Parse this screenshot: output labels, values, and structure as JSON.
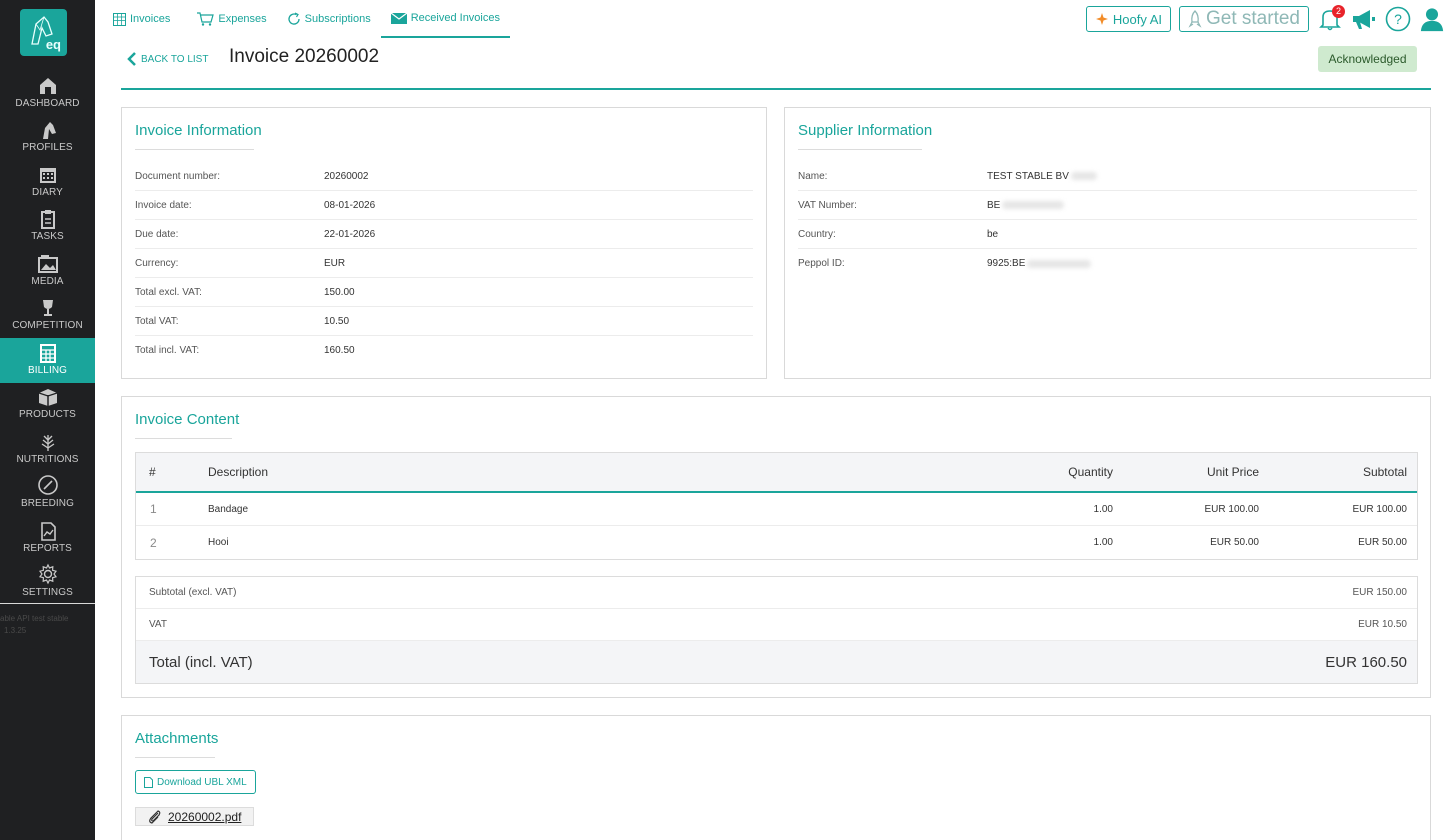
{
  "sidebar": {
    "logo_text": "eq",
    "items": [
      {
        "label": "DASHBOARD",
        "icon": "barn-icon"
      },
      {
        "label": "PROFILES",
        "icon": "horse-head-icon"
      },
      {
        "label": "DIARY",
        "icon": "calendar-icon"
      },
      {
        "label": "TASKS",
        "icon": "clipboard-icon"
      },
      {
        "label": "MEDIA",
        "icon": "media-icon"
      },
      {
        "label": "COMPETITION",
        "icon": "trophy-icon"
      },
      {
        "label": "BILLING",
        "icon": "billing-grid-icon",
        "active": true
      },
      {
        "label": "PRODUCTS",
        "icon": "box-icon"
      },
      {
        "label": "NUTRITIONS",
        "icon": "wheat-icon"
      },
      {
        "label": "BREEDING",
        "icon": "breeding-icon"
      },
      {
        "label": "REPORTS",
        "icon": "report-icon"
      },
      {
        "label": "SETTINGS",
        "icon": "gear-icon"
      }
    ],
    "footer_line1": "able API test stable",
    "footer_line2": "1.3.25"
  },
  "topbar": {
    "tabs": [
      {
        "label": "Invoices",
        "icon": "table-icon"
      },
      {
        "label": "Expenses",
        "icon": "cart-icon"
      },
      {
        "label": "Subscriptions",
        "icon": "refresh-icon"
      },
      {
        "label": "Received Invoices",
        "icon": "envelope-icon",
        "active": true
      }
    ],
    "hoofy_label": "Hoofy AI",
    "get_started_label": "Get started",
    "notification_count": "2"
  },
  "header": {
    "back_label": "BACK TO LIST",
    "title": "Invoice 20260002",
    "status": "Acknowledged"
  },
  "invoice_info": {
    "title": "Invoice Information",
    "rows": [
      {
        "key": "Document number:",
        "value": "20260002"
      },
      {
        "key": "Invoice date:",
        "value": "08-01-2026"
      },
      {
        "key": "Due date:",
        "value": "22-01-2026"
      },
      {
        "key": "Currency:",
        "value": "EUR"
      },
      {
        "key": "Total excl. VAT:",
        "value": "150.00"
      },
      {
        "key": "Total VAT:",
        "value": "10.50"
      },
      {
        "key": "Total incl. VAT:",
        "value": "160.50"
      }
    ]
  },
  "supplier_info": {
    "title": "Supplier Information",
    "rows": [
      {
        "key": "Name:",
        "value": "TEST STABLE BV"
      },
      {
        "key": "VAT Number:",
        "value": "BE"
      },
      {
        "key": "Country:",
        "value": "be"
      },
      {
        "key": "Peppol ID:",
        "value": "9925:BE"
      }
    ]
  },
  "content": {
    "title": "Invoice Content",
    "headers": {
      "num": "#",
      "description": "Description",
      "quantity": "Quantity",
      "unit_price": "Unit Price",
      "subtotal": "Subtotal"
    },
    "rows": [
      {
        "num": "1",
        "description": "Bandage",
        "quantity": "1.00",
        "unit_price": "EUR 100.00",
        "subtotal": "EUR 100.00"
      },
      {
        "num": "2",
        "description": "Hooi",
        "quantity": "1.00",
        "unit_price": "EUR 50.00",
        "subtotal": "EUR 50.00"
      }
    ],
    "totals": {
      "subtotal_label": "Subtotal (excl. VAT)",
      "subtotal_value": "EUR 150.00",
      "vat_label": "VAT",
      "vat_value": "EUR 10.50",
      "total_label": "Total (incl. VAT)",
      "total_value": "EUR 160.50"
    }
  },
  "attachments": {
    "title": "Attachments",
    "download_label": "Download UBL XML",
    "file_name": "20260002.pdf"
  },
  "colors": {
    "accent": "#1aa59b",
    "sidebar": "#1f2022",
    "status_bg": "#cfeacf"
  }
}
